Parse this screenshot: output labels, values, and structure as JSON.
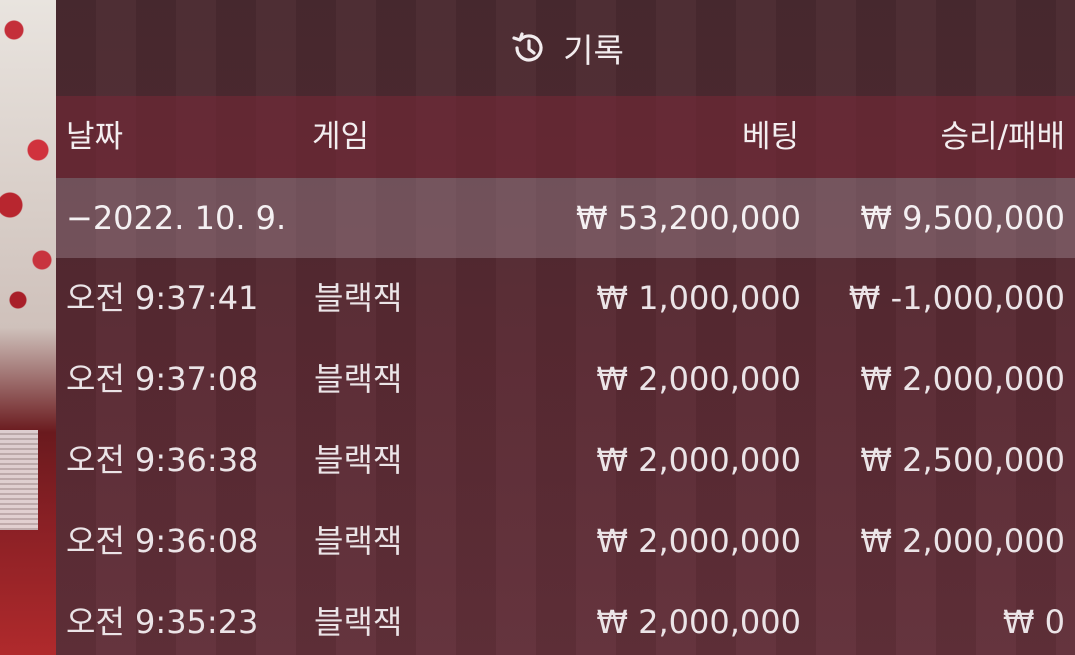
{
  "header": {
    "title": "기록",
    "icon": "history-icon"
  },
  "columns": {
    "date": "날짜",
    "game": "게임",
    "bet": "베팅",
    "result": "승리/패배"
  },
  "summary": {
    "date": "−2022. 10. 9.",
    "bet": "₩ 53,200,000",
    "result": "₩ 9,500,000"
  },
  "rows": [
    {
      "time": "오전 9:37:41",
      "game": "블랙잭",
      "bet": "₩ 1,000,000",
      "result": "₩ -1,000,000"
    },
    {
      "time": "오전 9:37:08",
      "game": "블랙잭",
      "bet": "₩ 2,000,000",
      "result": "₩ 2,000,000"
    },
    {
      "time": "오전 9:36:38",
      "game": "블랙잭",
      "bet": "₩ 2,000,000",
      "result": "₩ 2,500,000"
    },
    {
      "time": "오전 9:36:08",
      "game": "블랙잭",
      "bet": "₩ 2,000,000",
      "result": "₩ 2,000,000"
    },
    {
      "time": "오전 9:35:23",
      "game": "블랙잭",
      "bet": "₩ 2,000,000",
      "result": "₩ 0"
    }
  ]
}
